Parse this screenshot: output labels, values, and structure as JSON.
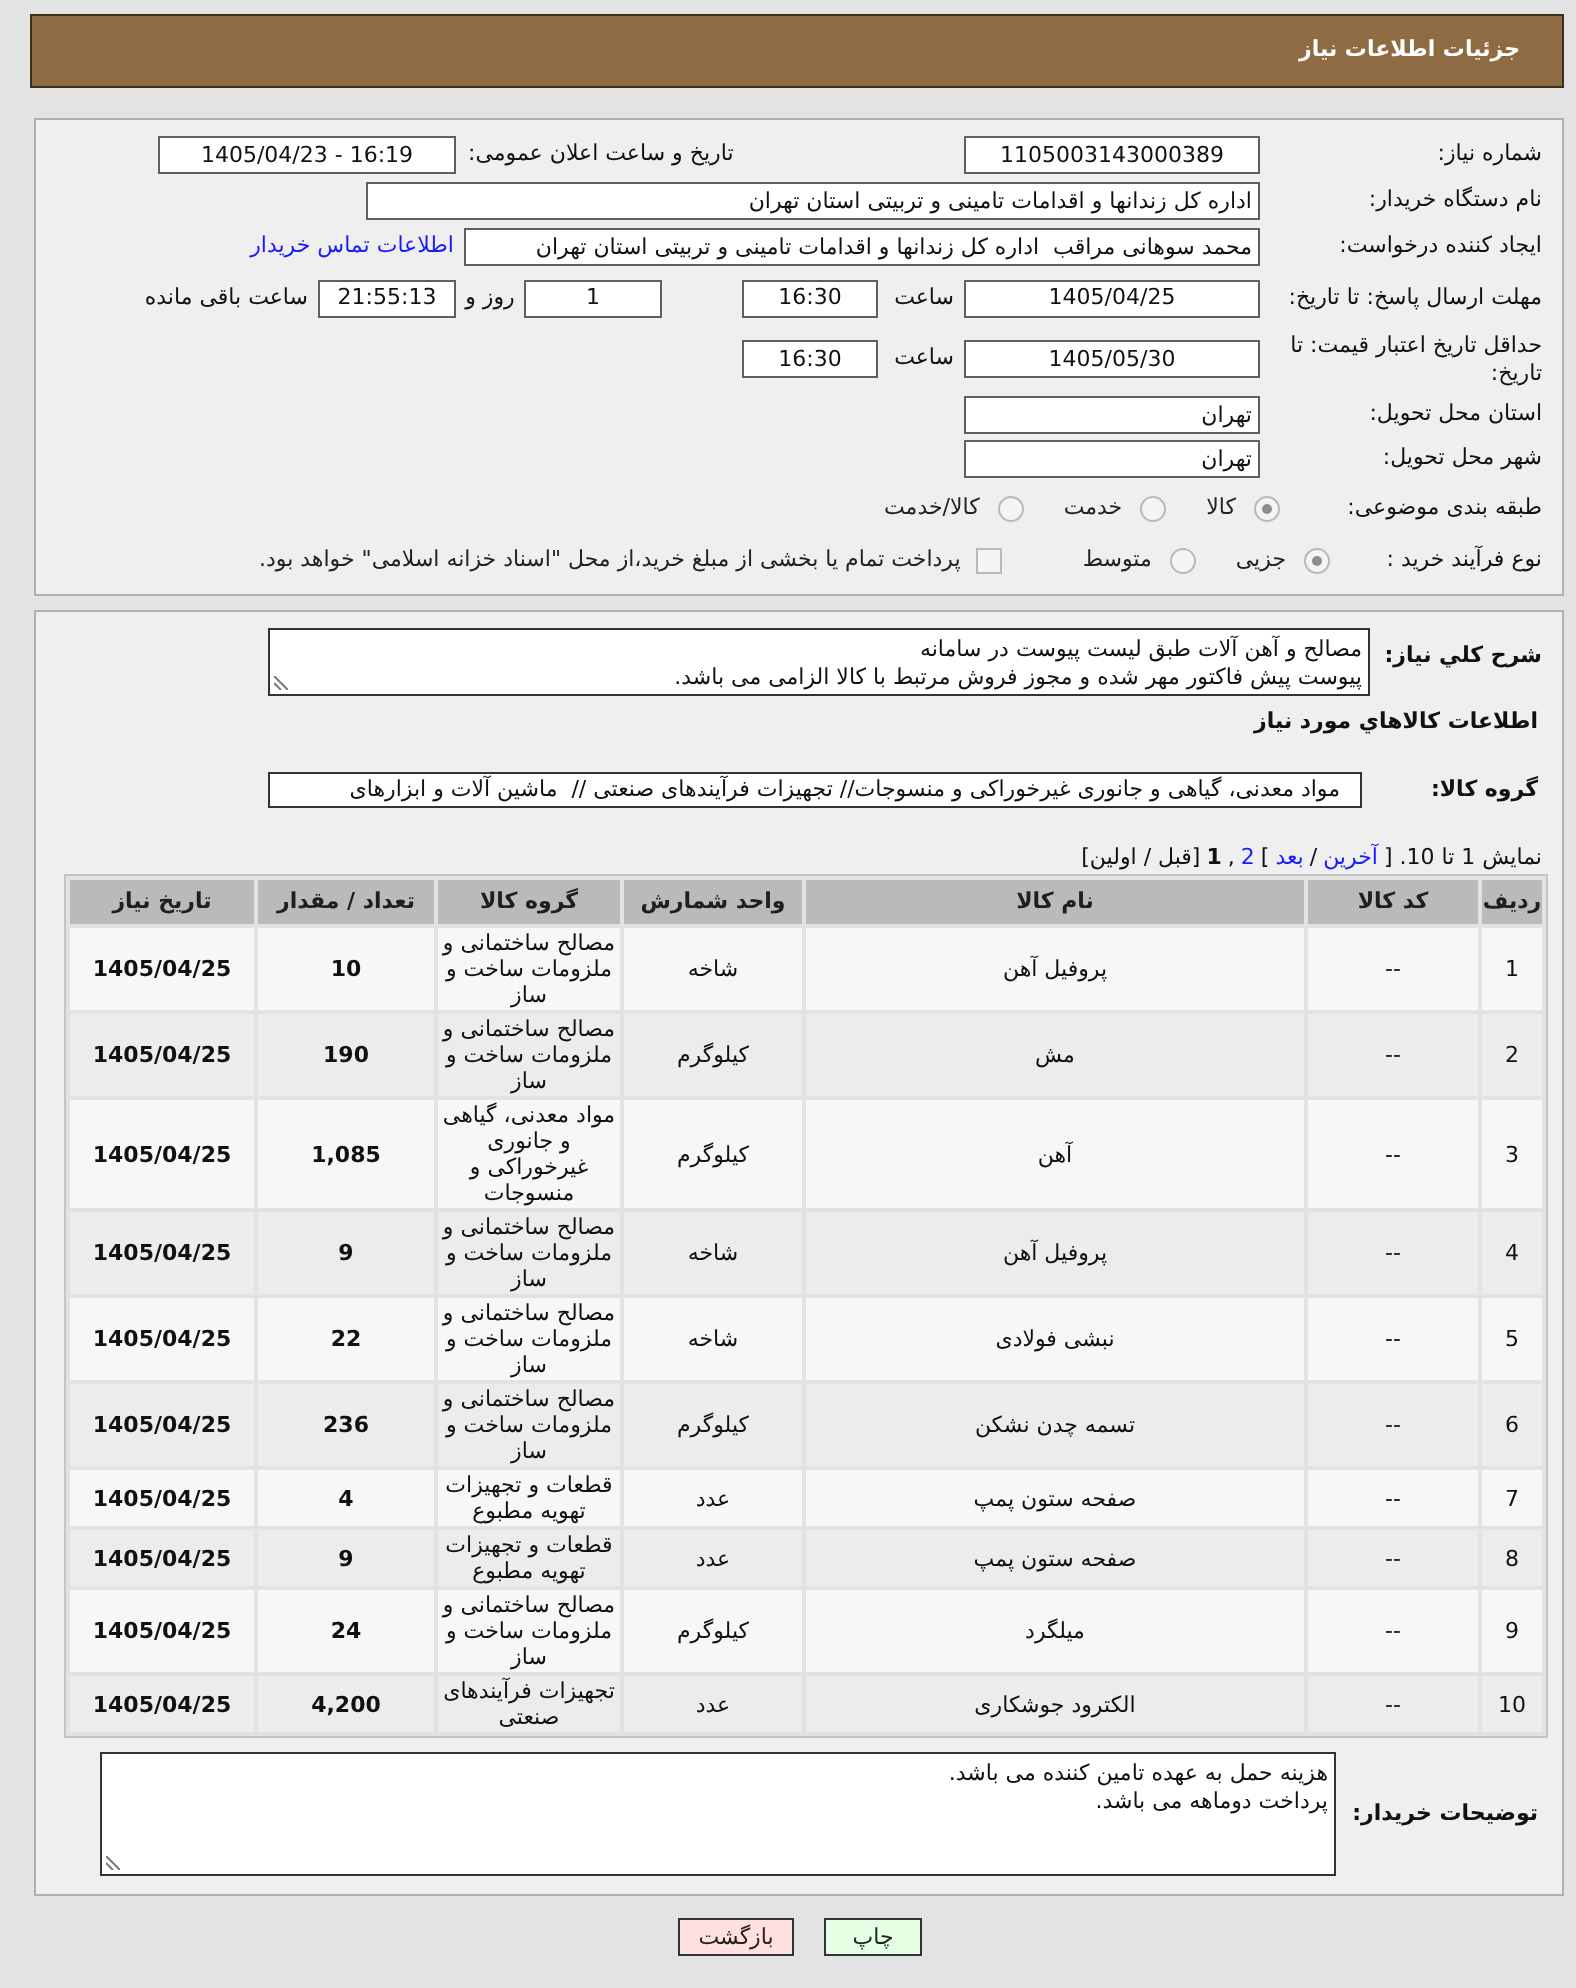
{
  "header": {
    "title": "جزئیات اطلاعات نیاز"
  },
  "details": {
    "need_number": {
      "label": "شماره نیاز:",
      "value": "1105003143000389"
    },
    "announcement": {
      "label": "تاریخ و ساعت اعلان عمومی:",
      "value": "1405/04/23 - 16:19"
    },
    "buyer": {
      "label": "نام دستگاه خریدار:",
      "value": "اداره کل زندانها و اقدامات تامینی و تربیتی استان تهران"
    },
    "requester": {
      "label": "ایجاد کننده درخواست:",
      "value": "محمد سوهانی مراقب  اداره کل زندانها و اقدامات تامینی و تربیتی استان تهران",
      "link": "اطلاعات تماس خریدار"
    },
    "reply_deadline": {
      "label": "مهلت ارسال پاسخ: تا تاریخ:",
      "date": "1405/04/25",
      "time_label": "ساعت",
      "time": "16:30",
      "days": "1",
      "days_label": "روز و",
      "remaining": "21:55:13",
      "remaining_label": "ساعت باقی مانده"
    },
    "price_validity": {
      "label": "حداقل تاریخ اعتبار قیمت: تا تاریخ:",
      "date": "1405/05/30",
      "time_label": "ساعت",
      "time": "16:30"
    },
    "province": {
      "label": "استان محل تحویل:",
      "value": "تهران"
    },
    "city": {
      "label": "شهر محل تحویل:",
      "value": "تهران"
    },
    "category": {
      "label": "طبقه بندی موضوعی:",
      "options": [
        {
          "label": "کالا",
          "selected": true
        },
        {
          "label": "خدمت",
          "selected": false
        },
        {
          "label": "کالا/خدمت",
          "selected": false
        }
      ]
    },
    "process": {
      "label": "نوع فرآیند خرید :",
      "options": [
        {
          "label": "جزیی",
          "selected": true
        },
        {
          "label": "متوسط",
          "selected": false
        }
      ],
      "treasury": {
        "label": "پرداخت تمام یا بخشی از مبلغ خرید،از محل \"اسناد خزانه اسلامی\" خواهد بود.",
        "checked": false
      }
    }
  },
  "needs": {
    "description_label": "شرح کلي نياز:",
    "description": "مصالح و آهن آلات طبق لیست پیوست در سامانه\nپیوست پیش فاکتور مهر شده و مجوز فروش مرتبط با کالا الزامی می باشد.",
    "goods_title": "اطلاعات کالاهاي مورد نياز",
    "group_label": "گروه کالا:",
    "group_value": "مواد معدنی، گیاهی و جانوری غیرخوراکی و منسوجات// تجهیزات فرآیندهای صنعتی //  ماشین آلات و ابزارهای",
    "pagination": [
      {
        "kind": "text",
        "label": "نمایش 1 تا 10. ["
      },
      {
        "kind": "link",
        "label": "آخرین"
      },
      {
        "kind": "text",
        "label": "/"
      },
      {
        "kind": "link",
        "label": "بعد"
      },
      {
        "kind": "text",
        "label": "]"
      },
      {
        "kind": "link",
        "label": "2"
      },
      {
        "kind": "text",
        "label": ","
      },
      {
        "kind": "current",
        "label": "1"
      },
      {
        "kind": "text",
        "label": "[قبل / اولین]"
      }
    ],
    "table": {
      "columns": [
        "ردیف",
        "کد کالا",
        "نام کالا",
        "واحد شمارش",
        "گروه کالا",
        "تعداد / مقدار",
        "تاریخ نیاز"
      ],
      "rows": [
        [
          "1",
          "--",
          "پروفیل آهن",
          "شاخه",
          "مصالح ساختمانی و ملزومات ساخت و ساز",
          "10",
          "1405/04/25"
        ],
        [
          "2",
          "--",
          "مش",
          "کیلوگرم",
          "مصالح ساختمانی و ملزومات ساخت و ساز",
          "190",
          "1405/04/25"
        ],
        [
          "3",
          "--",
          "آهن",
          "کیلوگرم",
          "مواد معدنی، گیاهی و جانوری غیرخوراکی و منسوجات",
          "1,085",
          "1405/04/25"
        ],
        [
          "4",
          "--",
          "پروفیل آهن",
          "شاخه",
          "مصالح ساختمانی و ملزومات ساخت و ساز",
          "9",
          "1405/04/25"
        ],
        [
          "5",
          "--",
          "نبشی فولادی",
          "شاخه",
          "مصالح ساختمانی و ملزومات ساخت و ساز",
          "22",
          "1405/04/25"
        ],
        [
          "6",
          "--",
          "تسمه چدن نشکن",
          "کیلوگرم",
          "مصالح ساختمانی و ملزومات ساخت و ساز",
          "236",
          "1405/04/25"
        ],
        [
          "7",
          "--",
          "صفحه ستون پمپ",
          "عدد",
          "قطعات و تجهیزات تهویه مطبوع",
          "4",
          "1405/04/25"
        ],
        [
          "8",
          "--",
          "صفحه ستون پمپ",
          "عدد",
          "قطعات و تجهیزات تهویه مطبوع",
          "9",
          "1405/04/25"
        ],
        [
          "9",
          "--",
          "میلگرد",
          "کیلوگرم",
          "مصالح ساختمانی و ملزومات ساخت و ساز",
          "24",
          "1405/04/25"
        ],
        [
          "10",
          "--",
          "الکترود جوشکاری",
          "عدد",
          "تجهیزات فرآیندهای صنعتی",
          "4,200",
          "1405/04/25"
        ]
      ]
    },
    "remarks_label": "توضیحات خریدار:",
    "remarks": "هزینه حمل به عهده تامین کننده می باشد.\nپرداخت دوماهه می باشد."
  },
  "buttons": [
    {
      "kind": "print",
      "label": "چاپ"
    },
    {
      "kind": "back",
      "label": "بازگشت"
    }
  ]
}
